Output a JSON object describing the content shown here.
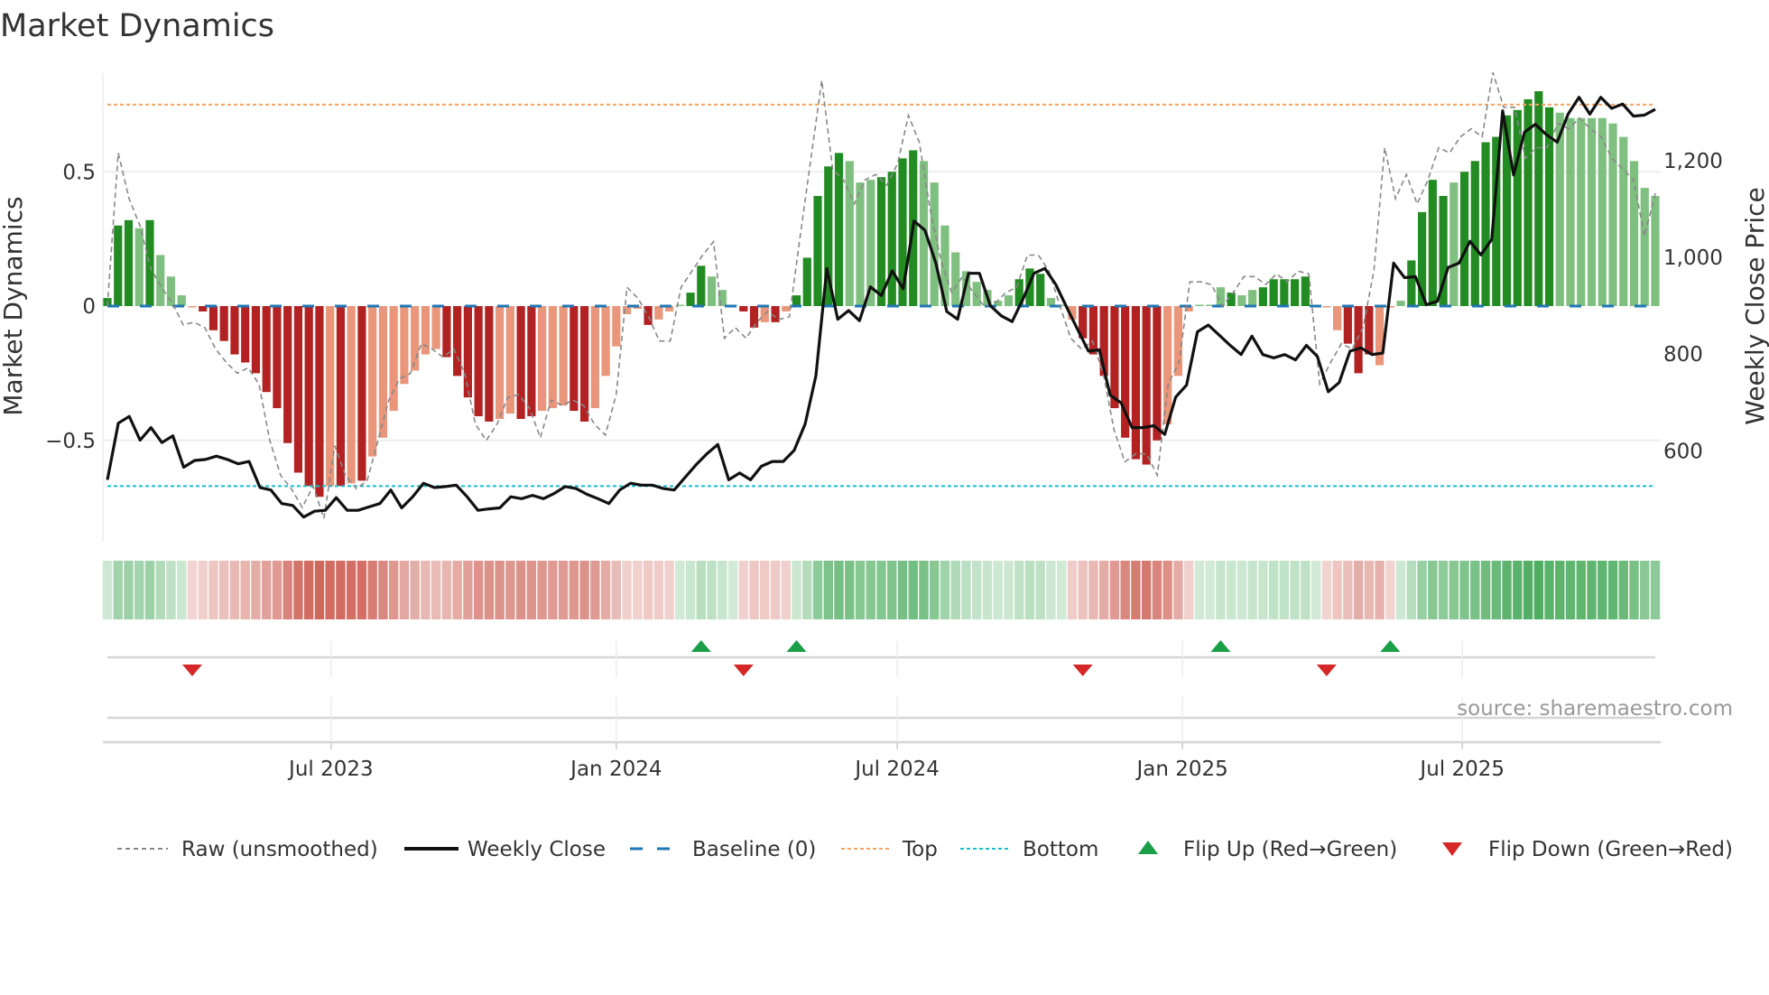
{
  "chart_data": {
    "type": "bar",
    "title": "Market Dynamics",
    "ylabel": "Market Dynamics",
    "y2label": "Weekly Close Price",
    "ylim": [
      -0.87,
      0.87
    ],
    "y2lim": [
      440,
      1400
    ],
    "yticks": [
      {
        "value": 0.5,
        "label": "0.5"
      },
      {
        "value": 0,
        "label": "0"
      },
      {
        "value": -0.5,
        "label": "−0.5"
      }
    ],
    "y2ticks": [
      {
        "value": 1200,
        "label": "1,200"
      },
      {
        "value": 1000,
        "label": "1,000"
      },
      {
        "value": 800,
        "label": "800"
      },
      {
        "value": 600,
        "label": "600"
      }
    ],
    "xticks": [
      {
        "week": 21.1,
        "label": "Jul 2023"
      },
      {
        "week": 48.0,
        "label": "Jan 2024"
      },
      {
        "week": 74.5,
        "label": "Jul 2024"
      },
      {
        "week": 101.4,
        "label": "Jan 2025"
      },
      {
        "week": 127.8,
        "label": "Jul 2025"
      }
    ],
    "levels": {
      "top": 0.75,
      "bottom": -0.67,
      "baseline": 0
    },
    "colors": {
      "up_strong": "#228b22",
      "up_weak": "#7fbf7f",
      "down_strong": "#b22222",
      "down_weak": "#e9967a",
      "raw": "#888888",
      "close": "#111111",
      "baseline": "#1f77b4",
      "top": "#f4a460",
      "bottom": "#17becf",
      "flip_up": "#1a9e48",
      "flip_down": "#d62728",
      "heat_green": "#2e9e44",
      "heat_red": "#c0392b"
    },
    "dynamics": [
      0.03,
      0.3,
      0.32,
      0.29,
      0.32,
      0.19,
      0.11,
      0.04,
      -0.005,
      -0.02,
      -0.09,
      -0.13,
      -0.18,
      -0.21,
      -0.25,
      -0.32,
      -0.38,
      -0.51,
      -0.62,
      -0.67,
      -0.71,
      -0.67,
      -0.67,
      -0.66,
      -0.65,
      -0.56,
      -0.49,
      -0.39,
      -0.29,
      -0.24,
      -0.18,
      -0.16,
      -0.19,
      -0.26,
      -0.34,
      -0.41,
      -0.43,
      -0.42,
      -0.4,
      -0.42,
      -0.41,
      -0.39,
      -0.38,
      -0.37,
      -0.39,
      -0.43,
      -0.38,
      -0.26,
      -0.15,
      -0.03,
      -0.01,
      -0.07,
      -0.05,
      -0.02,
      0.005,
      0.05,
      0.15,
      0.11,
      0.06,
      0.005,
      -0.02,
      -0.08,
      -0.06,
      -0.06,
      -0.02,
      0.04,
      0.18,
      0.41,
      0.52,
      0.57,
      0.54,
      0.46,
      0.47,
      0.48,
      0.5,
      0.55,
      0.58,
      0.54,
      0.46,
      0.3,
      0.2,
      0.13,
      0.09,
      0.06,
      0.02,
      0.04,
      0.1,
      0.14,
      0.12,
      0.03,
      0.005,
      -0.05,
      -0.12,
      -0.18,
      -0.26,
      -0.38,
      -0.49,
      -0.57,
      -0.59,
      -0.5,
      -0.44,
      -0.26,
      -0.02,
      0.005,
      0.005,
      0.07,
      0.05,
      0.04,
      0.06,
      0.07,
      0.1,
      0.1,
      0.1,
      0.11,
      0.005,
      -0.005,
      -0.09,
      -0.14,
      -0.25,
      -0.18,
      -0.22,
      -0.005,
      0.02,
      0.17,
      0.35,
      0.47,
      0.41,
      0.46,
      0.5,
      0.54,
      0.61,
      0.63,
      0.71,
      0.73,
      0.77,
      0.8,
      0.74,
      0.72,
      0.7,
      0.7,
      0.7,
      0.7,
      0.68,
      0.63,
      0.54,
      0.44,
      0.41
    ],
    "strength": "DDDLDLLLLDDDDDDDDDDDDLDLDLLLLLLLDDDDDLLDDLLLDDLLLLLDLLLDDLLLDDLDLDDDDDLLLDDDDLLLLLLLLLDDDLLLDDDDDDDDLLLLLLDLLDDDDDDLLDDDLLLDDDDLDDDDDDDDDLLLLLLLLLLL",
    "raw": [
      0,
      0.57,
      0.4,
      0.3,
      0.14,
      0.07,
      0.01,
      -0.07,
      -0.06,
      -0.08,
      -0.16,
      -0.21,
      -0.25,
      -0.23,
      -0.29,
      -0.5,
      -0.63,
      -0.68,
      -0.75,
      -0.67,
      -0.79,
      -0.52,
      -0.63,
      -0.68,
      -0.65,
      -0.5,
      -0.35,
      -0.27,
      -0.25,
      -0.14,
      -0.16,
      -0.19,
      -0.16,
      -0.25,
      -0.44,
      -0.5,
      -0.44,
      -0.34,
      -0.33,
      -0.38,
      -0.49,
      -0.35,
      -0.37,
      -0.35,
      -0.37,
      -0.44,
      -0.48,
      -0.33,
      0.07,
      0.03,
      -0.04,
      -0.13,
      -0.13,
      0.07,
      0.13,
      0.19,
      0.24,
      -0.12,
      -0.08,
      -0.12,
      -0.06,
      -0.02,
      -0.05,
      -0.04,
      0.26,
      0.55,
      0.84,
      0.51,
      0.47,
      0.38,
      0.47,
      0.49,
      0.45,
      0.53,
      0.71,
      0.61,
      0.36,
      0.17,
      0.05,
      0.11,
      0.05,
      0,
      0.01,
      0.05,
      0.07,
      0.19,
      0.19,
      0.13,
      0,
      -0.12,
      -0.16,
      -0.13,
      -0.25,
      -0.46,
      -0.58,
      -0.55,
      -0.55,
      -0.63,
      -0.29,
      -0.21,
      0.09,
      0.09,
      0.08,
      0,
      0.05,
      0.11,
      0.11,
      0.08,
      0.12,
      0.09,
      0.13,
      0.12,
      -0.29,
      -0.21,
      -0.14,
      -0.16,
      -0.08,
      0.13,
      0.59,
      0.4,
      0.49,
      0.38,
      0.47,
      0.59,
      0.57,
      0.63,
      0.66,
      0.63,
      0.87,
      0.74,
      0.74,
      0.55,
      0.59,
      0.59,
      0.68,
      0.66,
      0.7,
      0.66,
      0.63,
      0.55,
      0.51,
      0.47,
      0.26,
      0.42
    ],
    "weekly_close": [
      540,
      657,
      671,
      622,
      648,
      617,
      631,
      566,
      580,
      582,
      589,
      582,
      573,
      578,
      524,
      519,
      491,
      487,
      463,
      475,
      477,
      503,
      477,
      477,
      484,
      491,
      519,
      482,
      505,
      533,
      524,
      526,
      529,
      505,
      477,
      480,
      482,
      505,
      501,
      508,
      501,
      512,
      526,
      522,
      510,
      501,
      491,
      519,
      533,
      529,
      529,
      522,
      519,
      545,
      571,
      594,
      613,
      540,
      554,
      540,
      568,
      578,
      578,
      601,
      655,
      755,
      977,
      872,
      890,
      869,
      939,
      921,
      972,
      935,
      1075,
      1056,
      988,
      888,
      872,
      967,
      967,
      900,
      879,
      867,
      914,
      967,
      977,
      944,
      897,
      851,
      806,
      809,
      715,
      699,
      648,
      648,
      652,
      634,
      711,
      736,
      846,
      860,
      839,
      818,
      799,
      837,
      799,
      792,
      799,
      788,
      818,
      795,
      722,
      741,
      806,
      813,
      799,
      802,
      988,
      958,
      960,
      902,
      909,
      979,
      988,
      1033,
      1005,
      1037,
      1303,
      1170,
      1259,
      1275,
      1254,
      1238,
      1296,
      1331,
      1296,
      1331,
      1308,
      1317,
      1292,
      1294,
      1306
    ],
    "flip_up_weeks": [
      56,
      65,
      105,
      121
    ],
    "flip_down_weeks": [
      8,
      60,
      92,
      115
    ],
    "legend": [
      {
        "key": "raw",
        "label": "Raw (unsmoothed)"
      },
      {
        "key": "close",
        "label": "Weekly Close"
      },
      {
        "key": "baseline",
        "label": "Baseline (0)"
      },
      {
        "key": "top",
        "label": "Top"
      },
      {
        "key": "bottom",
        "label": "Bottom"
      },
      {
        "key": "flip_up",
        "label": "Flip Up (Red→Green)"
      },
      {
        "key": "flip_down",
        "label": "Flip Down (Green→Red)"
      }
    ],
    "legend_position": "bottom",
    "source": "source: sharemaestro.com"
  }
}
